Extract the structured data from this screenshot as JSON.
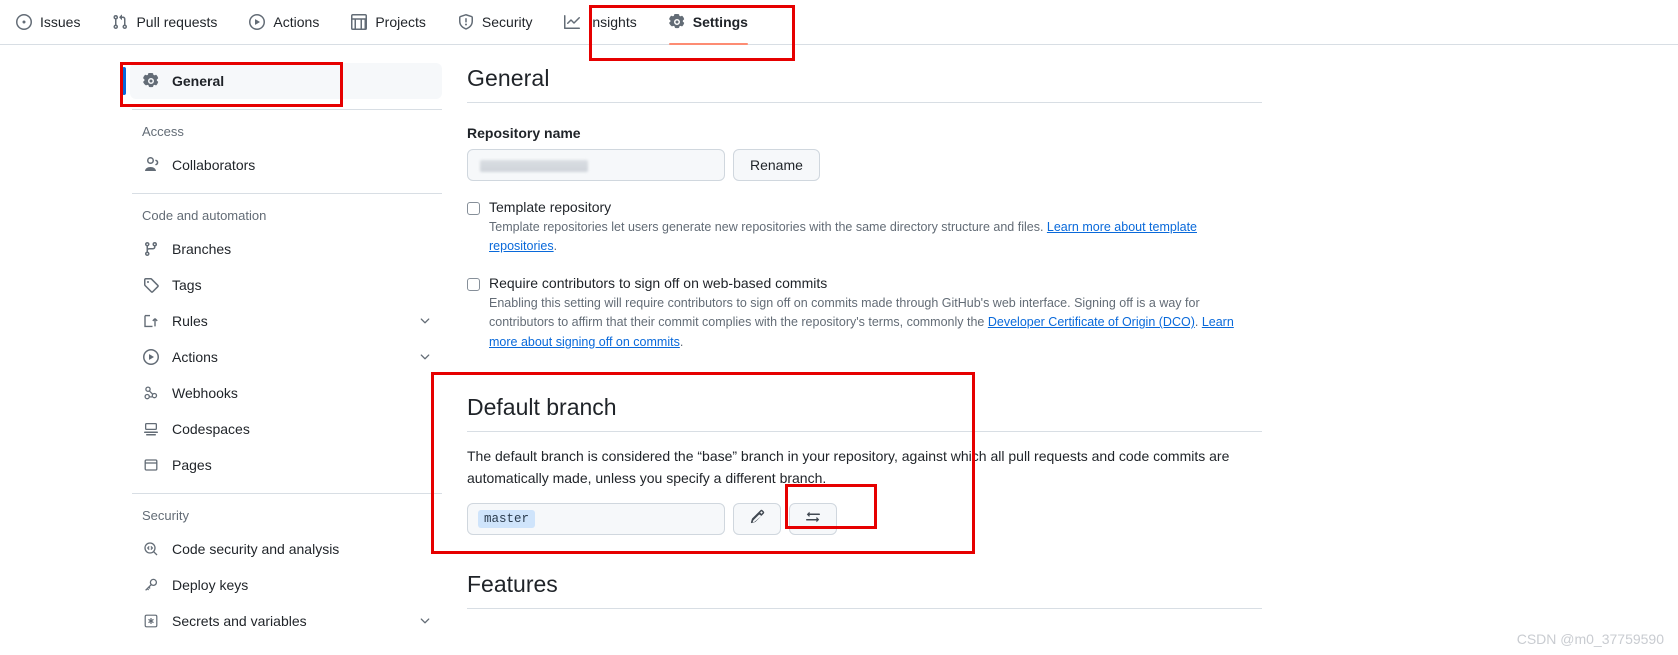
{
  "repo_nav": {
    "items": [
      {
        "label": "Issues",
        "icon": "issue-opened-icon",
        "selected": false
      },
      {
        "label": "Pull requests",
        "icon": "git-pull-request-icon",
        "selected": false
      },
      {
        "label": "Actions",
        "icon": "play-icon",
        "selected": false
      },
      {
        "label": "Projects",
        "icon": "table-icon",
        "selected": false
      },
      {
        "label": "Security",
        "icon": "shield-icon",
        "selected": false
      },
      {
        "label": "Insights",
        "icon": "graph-icon",
        "selected": false
      },
      {
        "label": "Settings",
        "icon": "gear-icon",
        "selected": true
      }
    ]
  },
  "sidebar": {
    "general": {
      "label": "General",
      "icon": "gear-icon"
    },
    "groups": [
      {
        "heading": "Access",
        "items": [
          {
            "label": "Collaborators",
            "icon": "people-icon",
            "expandable": false
          }
        ]
      },
      {
        "heading": "Code and automation",
        "items": [
          {
            "label": "Branches",
            "icon": "git-branch-icon",
            "expandable": false
          },
          {
            "label": "Tags",
            "icon": "tag-icon",
            "expandable": false
          },
          {
            "label": "Rules",
            "icon": "rules-icon",
            "expandable": true
          },
          {
            "label": "Actions",
            "icon": "play-icon",
            "expandable": true
          },
          {
            "label": "Webhooks",
            "icon": "webhook-icon",
            "expandable": false
          },
          {
            "label": "Codespaces",
            "icon": "codespaces-icon",
            "expandable": false
          },
          {
            "label": "Pages",
            "icon": "browser-icon",
            "expandable": false
          }
        ]
      },
      {
        "heading": "Security",
        "items": [
          {
            "label": "Code security and analysis",
            "icon": "code-scan-icon",
            "expandable": false
          },
          {
            "label": "Deploy keys",
            "icon": "key-icon",
            "expandable": false
          },
          {
            "label": "Secrets and variables",
            "icon": "asterisk-box-icon",
            "expandable": true
          }
        ]
      }
    ]
  },
  "main": {
    "title": "General",
    "repository_name": {
      "label": "Repository name",
      "value": "",
      "redacted": true,
      "rename_label": "Rename"
    },
    "template_repository": {
      "title": "Template repository",
      "checked": false,
      "desc_before": "Template repositories let users generate new repositories with the same directory structure and files. ",
      "link": "Learn more about template repositories",
      "desc_after": "."
    },
    "require_signoff": {
      "title": "Require contributors to sign off on web-based commits",
      "checked": false,
      "desc_part1": "Enabling this setting will require contributors to sign off on commits made through GitHub's web interface. Signing off is a way for contributors to affirm that their commit complies with the repository's terms, commonly the ",
      "link1": "Developer Certificate of Origin (DCO)",
      "desc_part2": ". ",
      "link2": "Learn more about signing off on commits",
      "desc_part3": "."
    },
    "default_branch": {
      "title": "Default branch",
      "description": "The default branch is considered the “base” branch in your repository, against which all pull requests and code commits are automatically made, unless you specify a different branch.",
      "branch_name": "master",
      "edit_icon": "pencil-icon",
      "switch_icon": "arrow-switch-icon"
    },
    "features": {
      "title": "Features"
    }
  },
  "watermark": "CSDN @m0_37759590",
  "colors": {
    "accent": "#0969da",
    "tab_underline": "#fd8c73",
    "annotation": "#e60000",
    "branch_chip_bg": "#cfe4fb"
  }
}
